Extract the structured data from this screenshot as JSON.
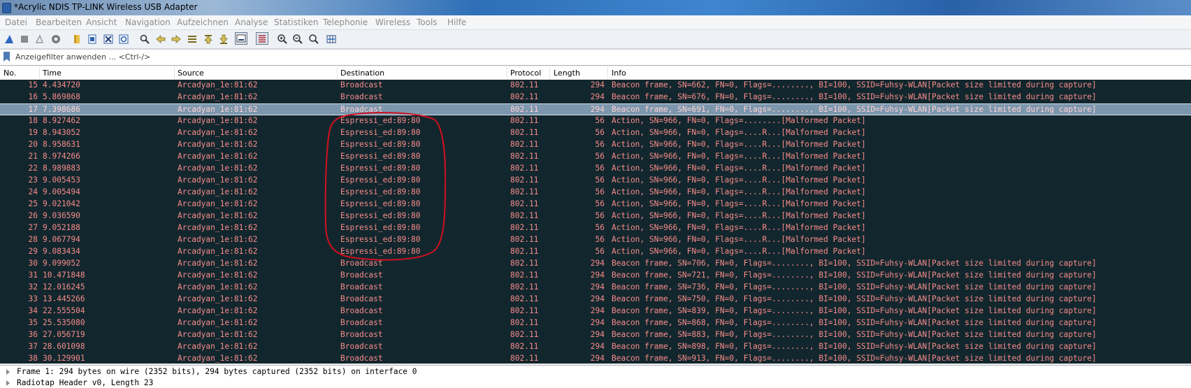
{
  "window": {
    "title": "*Acrylic NDIS TP-LINK Wireless USB Adapter"
  },
  "menu": [
    "Datei",
    "Bearbeiten",
    "Ansicht",
    "Navigation",
    "Aufzeichnen",
    "Analyse",
    "Statistiken",
    "Telephonie",
    "Wireless",
    "Tools",
    "Hilfe"
  ],
  "toolbar": {
    "icons": [
      "shark-fin-start-icon",
      "stop-icon",
      "restart-icon",
      "capture-options-icon",
      "open-folder-icon",
      "file-save-icon",
      "close-file-icon",
      "reload-icon",
      "find-icon",
      "go-back-icon",
      "go-forward-icon",
      "go-to-packet-icon",
      "go-first-icon",
      "go-last-icon",
      "autoscroll-icon",
      "colorize-icon",
      "zoom-in-icon",
      "zoom-out-icon",
      "zoom-normal-icon",
      "resize-columns-icon"
    ]
  },
  "filter": {
    "placeholder": "Anzeigefilter anwenden ... <Ctrl-/>"
  },
  "columns": {
    "no": "No.",
    "time": "Time",
    "source": "Source",
    "destination": "Destination",
    "protocol": "Protocol",
    "length": "Length",
    "info": "Info"
  },
  "colors": {
    "packet_bg": "#12272d",
    "packet_fg": "#f78b8b",
    "selected_bg": "#7b96ad",
    "annotation": "#d01020"
  },
  "selected_row": 2,
  "packets": [
    {
      "no": "15",
      "time": "4.434720",
      "src": "Arcadyan_1e:81:62",
      "dst": "Broadcast",
      "proto": "802.11",
      "len": "294",
      "info": "Beacon frame, SN=662, FN=0, Flags=........, BI=100, SSID=Fuhsy-WLAN[Packet size limited during capture]"
    },
    {
      "no": "16",
      "time": "5.869868",
      "src": "Arcadyan_1e:81:62",
      "dst": "Broadcast",
      "proto": "802.11",
      "len": "294",
      "info": "Beacon frame, SN=676, FN=0, Flags=........, BI=100, SSID=Fuhsy-WLAN[Packet size limited during capture]"
    },
    {
      "no": "17",
      "time": "7.398686",
      "src": "Arcadyan_1e:81:62",
      "dst": "Broadcast",
      "proto": "802.11",
      "len": "294",
      "info": "Beacon frame, SN=691, FN=0, Flags=........, BI=100, SSID=Fuhsy-WLAN[Packet size limited during capture]"
    },
    {
      "no": "18",
      "time": "8.927462",
      "src": "Arcadyan_1e:81:62",
      "dst": "Espressi_ed:89:80",
      "proto": "802.11",
      "len": "56",
      "info": "Action, SN=966, FN=0, Flags=........[Malformed Packet]"
    },
    {
      "no": "19",
      "time": "8.943052",
      "src": "Arcadyan_1e:81:62",
      "dst": "Espressi_ed:89:80",
      "proto": "802.11",
      "len": "56",
      "info": "Action, SN=966, FN=0, Flags=....R...[Malformed Packet]"
    },
    {
      "no": "20",
      "time": "8.958631",
      "src": "Arcadyan_1e:81:62",
      "dst": "Espressi_ed:89:80",
      "proto": "802.11",
      "len": "56",
      "info": "Action, SN=966, FN=0, Flags=....R...[Malformed Packet]"
    },
    {
      "no": "21",
      "time": "8.974266",
      "src": "Arcadyan_1e:81:62",
      "dst": "Espressi_ed:89:80",
      "proto": "802.11",
      "len": "56",
      "info": "Action, SN=966, FN=0, Flags=....R...[Malformed Packet]"
    },
    {
      "no": "22",
      "time": "8.989883",
      "src": "Arcadyan_1e:81:62",
      "dst": "Espressi_ed:89:80",
      "proto": "802.11",
      "len": "56",
      "info": "Action, SN=966, FN=0, Flags=....R...[Malformed Packet]"
    },
    {
      "no": "23",
      "time": "9.005453",
      "src": "Arcadyan_1e:81:62",
      "dst": "Espressi_ed:89:80",
      "proto": "802.11",
      "len": "56",
      "info": "Action, SN=966, FN=0, Flags=....R...[Malformed Packet]"
    },
    {
      "no": "24",
      "time": "9.005494",
      "src": "Arcadyan_1e:81:62",
      "dst": "Espressi_ed:89:80",
      "proto": "802.11",
      "len": "56",
      "info": "Action, SN=966, FN=0, Flags=....R...[Malformed Packet]"
    },
    {
      "no": "25",
      "time": "9.021042",
      "src": "Arcadyan_1e:81:62",
      "dst": "Espressi_ed:89:80",
      "proto": "802.11",
      "len": "56",
      "info": "Action, SN=966, FN=0, Flags=....R...[Malformed Packet]"
    },
    {
      "no": "26",
      "time": "9.036590",
      "src": "Arcadyan_1e:81:62",
      "dst": "Espressi_ed:89:80",
      "proto": "802.11",
      "len": "56",
      "info": "Action, SN=966, FN=0, Flags=....R...[Malformed Packet]"
    },
    {
      "no": "27",
      "time": "9.052188",
      "src": "Arcadyan_1e:81:62",
      "dst": "Espressi_ed:89:80",
      "proto": "802.11",
      "len": "56",
      "info": "Action, SN=966, FN=0, Flags=....R...[Malformed Packet]"
    },
    {
      "no": "28",
      "time": "9.067794",
      "src": "Arcadyan_1e:81:62",
      "dst": "Espressi_ed:89:80",
      "proto": "802.11",
      "len": "56",
      "info": "Action, SN=966, FN=0, Flags=....R...[Malformed Packet]"
    },
    {
      "no": "29",
      "time": "9.083434",
      "src": "Arcadyan_1e:81:62",
      "dst": "Espressi_ed:89:80",
      "proto": "802.11",
      "len": "56",
      "info": "Action, SN=966, FN=0, Flags=....R...[Malformed Packet]"
    },
    {
      "no": "30",
      "time": "9.099052",
      "src": "Arcadyan_1e:81:62",
      "dst": "Broadcast",
      "proto": "802.11",
      "len": "294",
      "info": "Beacon frame, SN=706, FN=0, Flags=........, BI=100, SSID=Fuhsy-WLAN[Packet size limited during capture]"
    },
    {
      "no": "31",
      "time": "10.471848",
      "src": "Arcadyan_1e:81:62",
      "dst": "Broadcast",
      "proto": "802.11",
      "len": "294",
      "info": "Beacon frame, SN=721, FN=0, Flags=........, BI=100, SSID=Fuhsy-WLAN[Packet size limited during capture]"
    },
    {
      "no": "32",
      "time": "12.016245",
      "src": "Arcadyan_1e:81:62",
      "dst": "Broadcast",
      "proto": "802.11",
      "len": "294",
      "info": "Beacon frame, SN=736, FN=0, Flags=........, BI=100, SSID=Fuhsy-WLAN[Packet size limited during capture]"
    },
    {
      "no": "33",
      "time": "13.445266",
      "src": "Arcadyan_1e:81:62",
      "dst": "Broadcast",
      "proto": "802.11",
      "len": "294",
      "info": "Beacon frame, SN=750, FN=0, Flags=........, BI=100, SSID=Fuhsy-WLAN[Packet size limited during capture]"
    },
    {
      "no": "34",
      "time": "22.555504",
      "src": "Arcadyan_1e:81:62",
      "dst": "Broadcast",
      "proto": "802.11",
      "len": "294",
      "info": "Beacon frame, SN=839, FN=0, Flags=........, BI=100, SSID=Fuhsy-WLAN[Packet size limited during capture]"
    },
    {
      "no": "35",
      "time": "25.535080",
      "src": "Arcadyan_1e:81:62",
      "dst": "Broadcast",
      "proto": "802.11",
      "len": "294",
      "info": "Beacon frame, SN=868, FN=0, Flags=........, BI=100, SSID=Fuhsy-WLAN[Packet size limited during capture]"
    },
    {
      "no": "36",
      "time": "27.056719",
      "src": "Arcadyan_1e:81:62",
      "dst": "Broadcast",
      "proto": "802.11",
      "len": "294",
      "info": "Beacon frame, SN=883, FN=0, Flags=........, BI=100, SSID=Fuhsy-WLAN[Packet size limited during capture]"
    },
    {
      "no": "37",
      "time": "28.601098",
      "src": "Arcadyan_1e:81:62",
      "dst": "Broadcast",
      "proto": "802.11",
      "len": "294",
      "info": "Beacon frame, SN=898, FN=0, Flags=........, BI=100, SSID=Fuhsy-WLAN[Packet size limited during capture]"
    },
    {
      "no": "38",
      "time": "30.129901",
      "src": "Arcadyan_1e:81:62",
      "dst": "Broadcast",
      "proto": "802.11",
      "len": "294",
      "info": "Beacon frame, SN=913, FN=0, Flags=........, BI=100, SSID=Fuhsy-WLAN[Packet size limited during capture]"
    }
  ],
  "details": [
    "Frame 1: 294 bytes on wire (2352 bits), 294 bytes captured (2352 bits) on interface 0",
    "Radiotap Header v0, Length 23"
  ]
}
